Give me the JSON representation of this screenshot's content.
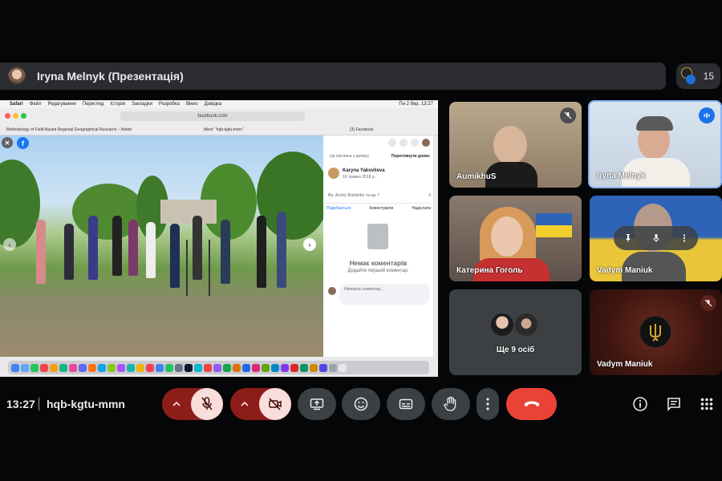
{
  "presenter": {
    "name": "Iryna Melnyk (Презентація)"
  },
  "participants": {
    "count": "15"
  },
  "shared_screen": {
    "mac_menu": [
      "Safari",
      "Файл",
      "Редагування",
      "Перегляд",
      "Історія",
      "Закладки",
      "Розробка",
      "Вікно",
      "Довідка"
    ],
    "clock_text": "Пн 2 бер. 13:27",
    "url": "facebook.com",
    "tabs": [
      "Methodology of Field-Based Regional Geographical Research – NotebookLM",
      "Meet: \"hqb-kgtu-mmn\"",
      "(3) Facebook"
    ],
    "fb": {
      "photo_owner_note": "Це світлина з допису",
      "view_post": "Переглянути допис",
      "author": "Karyna Yakovlieva",
      "date": "16 травня 2018 р. ·",
      "reactions": "Ви, Andriy Bratishko та ще 7",
      "reaction_count": "9",
      "actions": [
        "Подобається",
        "Коментувати",
        "Надіслати"
      ],
      "no_comments": "Немає коментарів",
      "be_first": "Додайте перший коментар.",
      "comment_placeholder": "Напишіть коментар..."
    }
  },
  "tiles": [
    {
      "name": "AumikhuS"
    },
    {
      "name": "Iryna Melnyk"
    },
    {
      "name": "Катерина Гоголь"
    },
    {
      "name": "Vadym Maniuk"
    },
    {
      "name": "Ще 9 осіб"
    },
    {
      "name": "Vadym Maniuk"
    }
  ],
  "bottom_bar": {
    "time": "13:27",
    "meeting_code": "hqb-kgtu-mmn"
  },
  "colors": {
    "background": "#050607",
    "tile_dark": "#3c4043",
    "hangup_red": "#ea4335",
    "off_state_bg": "#8c1d18",
    "off_state_pink": "#f9dedc",
    "speaking_blue": "#8ab4f8"
  },
  "icons": [
    "mic-off-icon",
    "camera-off-icon",
    "present-screen-icon",
    "emoji-icon",
    "captions-icon",
    "raise-hand-icon",
    "more-options-icon",
    "hang-up-icon",
    "info-icon",
    "chat-icon",
    "activities-grid-icon",
    "pin-icon",
    "chevron-up-icon"
  ]
}
